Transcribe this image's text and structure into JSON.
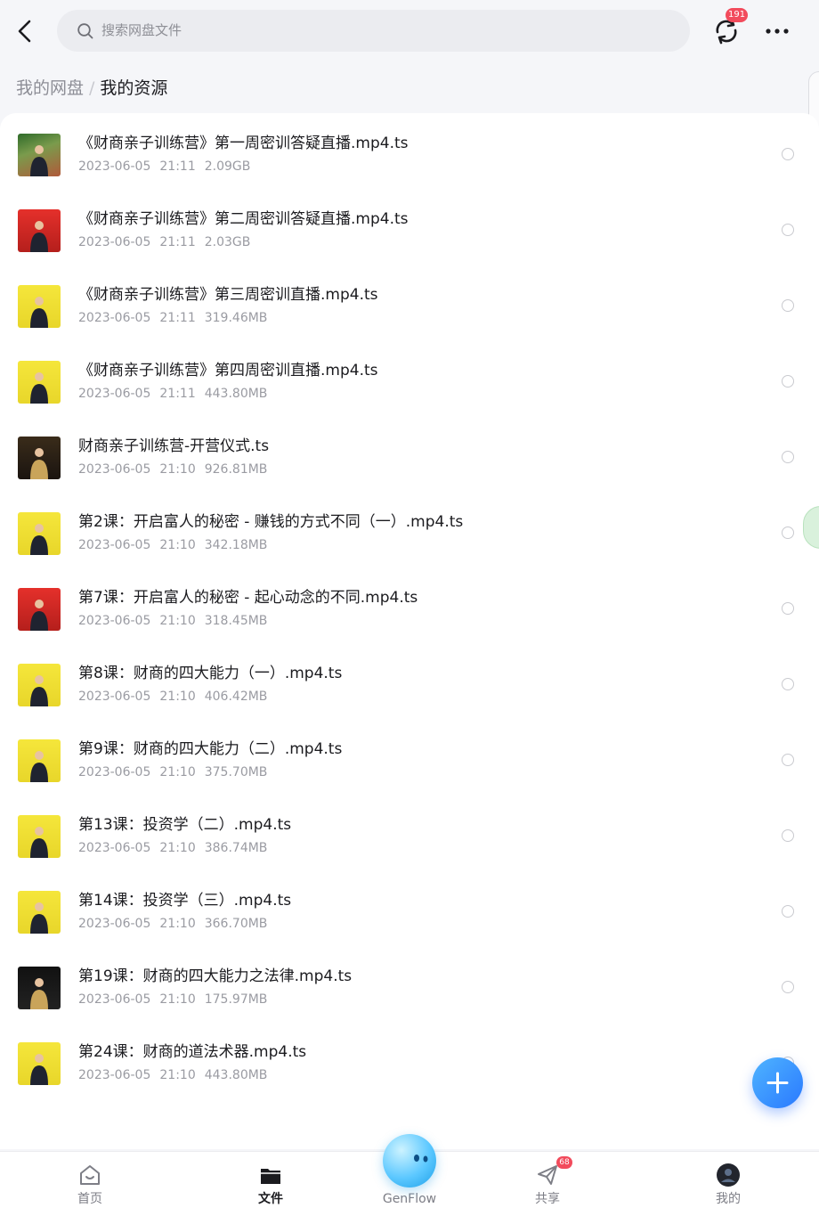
{
  "search": {
    "placeholder": "搜索网盘文件"
  },
  "sync_badge": "191",
  "breadcrumb": {
    "parent": "我的网盘",
    "separator": "/",
    "current": "我的资源"
  },
  "files": [
    {
      "name": "《财商亲子训练营》第一周密训答疑直播.mp4.ts",
      "date": "2023-06-05",
      "time": "21:11",
      "size": "2.09GB"
    },
    {
      "name": "《财商亲子训练营》第二周密训答疑直播.mp4.ts",
      "date": "2023-06-05",
      "time": "21:11",
      "size": "2.03GB"
    },
    {
      "name": "《财商亲子训练营》第三周密训直播.mp4.ts",
      "date": "2023-06-05",
      "time": "21:11",
      "size": "319.46MB"
    },
    {
      "name": "《财商亲子训练营》第四周密训直播.mp4.ts",
      "date": "2023-06-05",
      "time": "21:11",
      "size": "443.80MB"
    },
    {
      "name": "财商亲子训练营-开营仪式.ts",
      "date": "2023-06-05",
      "time": "21:10",
      "size": "926.81MB"
    },
    {
      "name": "第2课：开启富人的秘密 - 赚钱的方式不同（一）.mp4.ts",
      "date": "2023-06-05",
      "time": "21:10",
      "size": "342.18MB"
    },
    {
      "name": "第7课：开启富人的秘密 - 起心动念的不同.mp4.ts",
      "date": "2023-06-05",
      "time": "21:10",
      "size": "318.45MB"
    },
    {
      "name": "第8课：财商的四大能力（一）.mp4.ts",
      "date": "2023-06-05",
      "time": "21:10",
      "size": "406.42MB"
    },
    {
      "name": "第9课：财商的四大能力（二）.mp4.ts",
      "date": "2023-06-05",
      "time": "21:10",
      "size": "375.70MB"
    },
    {
      "name": "第13课：投资学（二）.mp4.ts",
      "date": "2023-06-05",
      "time": "21:10",
      "size": "386.74MB"
    },
    {
      "name": "第14课：投资学（三）.mp4.ts",
      "date": "2023-06-05",
      "time": "21:10",
      "size": "366.70MB"
    },
    {
      "name": "第19课：财商的四大能力之法律.mp4.ts",
      "date": "2023-06-05",
      "time": "21:10",
      "size": "175.97MB"
    },
    {
      "name": "第24课：财商的道法术器.mp4.ts",
      "date": "2023-06-05",
      "time": "21:10",
      "size": "443.80MB"
    }
  ],
  "thumb_styles": [
    "outdoor",
    "red",
    "yellow",
    "yellow",
    "dark",
    "yellow",
    "red",
    "yellow",
    "yellow",
    "yellow",
    "yellow",
    "black",
    "yellow"
  ],
  "tabs": [
    {
      "label": "首页",
      "icon": "home-icon",
      "active": false
    },
    {
      "label": "文件",
      "icon": "folder-icon",
      "active": true
    },
    {
      "label": "GenFlow",
      "icon": "genflow-icon",
      "active": false
    },
    {
      "label": "共享",
      "icon": "share-icon",
      "active": false
    },
    {
      "label": "我的",
      "icon": "avatar-icon",
      "active": false
    }
  ],
  "share_badge": "68",
  "colors": {
    "accent": "#2a79ff",
    "badge": "#f24b5c",
    "background": "#f5f6f9"
  }
}
